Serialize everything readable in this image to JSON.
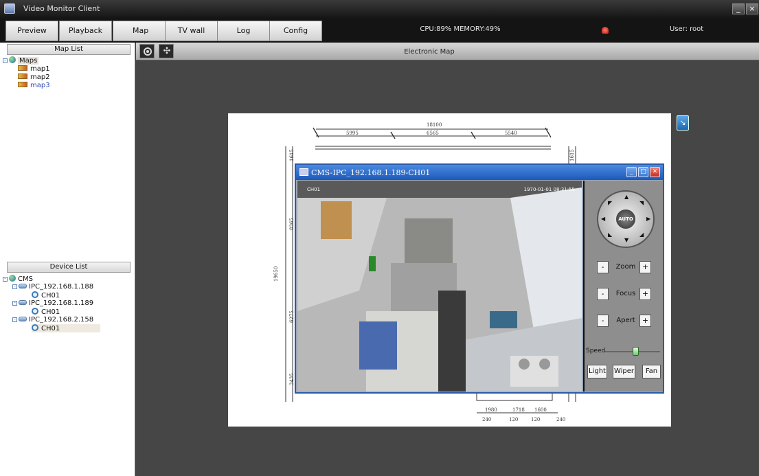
{
  "window": {
    "title": "Video Monitor Client",
    "minimize": "_",
    "close": "×"
  },
  "menu": {
    "tabs": [
      "Preview",
      "Playback",
      "Map",
      "TV wall",
      "Log",
      "Config"
    ],
    "status": "CPU:89% MEMORY:49%",
    "user": "User: root"
  },
  "map_list": {
    "header": "Map List",
    "root": "Maps",
    "items": [
      "map1",
      "map2",
      "map3"
    ],
    "selected": "map3"
  },
  "device_list": {
    "header": "Device List",
    "root": "CMS",
    "devices": [
      {
        "name": "IPC_192.168.1.188",
        "channel": "CH01"
      },
      {
        "name": "IPC_192.168.1.189",
        "channel": "CH01"
      },
      {
        "name": "IPC_192.168.2.158",
        "channel": "CH01"
      }
    ]
  },
  "map": {
    "title": "Electronic Map",
    "dims": {
      "top_total": "18100",
      "top_1": "5995",
      "top_2": "6565",
      "top_3": "5540",
      "left_1": "1615",
      "left_2": "8365",
      "left_3": "19650",
      "left_4": "6275",
      "left_5": "3435",
      "right_1": "1615",
      "bottom_1": "1980",
      "bottom_2": "1718",
      "bottom_3": "1600",
      "bottom_4": "240",
      "bottom_5": "120",
      "bottom_6": "120",
      "bottom_7": "240"
    }
  },
  "video": {
    "title": "CMS-IPC_192.168.1.189-CH01",
    "osd_channel": "CH01",
    "osd_time": "1970-01-01 08:31:55",
    "ptz": {
      "auto": "AUTO",
      "zoom": "Zoom",
      "focus": "Focus",
      "apert": "Apert",
      "minus": "-",
      "plus": "+",
      "speed": "Speed",
      "speed_level": 0.55,
      "light": "Light",
      "wiper": "Wiper",
      "fan": "Fan"
    }
  }
}
